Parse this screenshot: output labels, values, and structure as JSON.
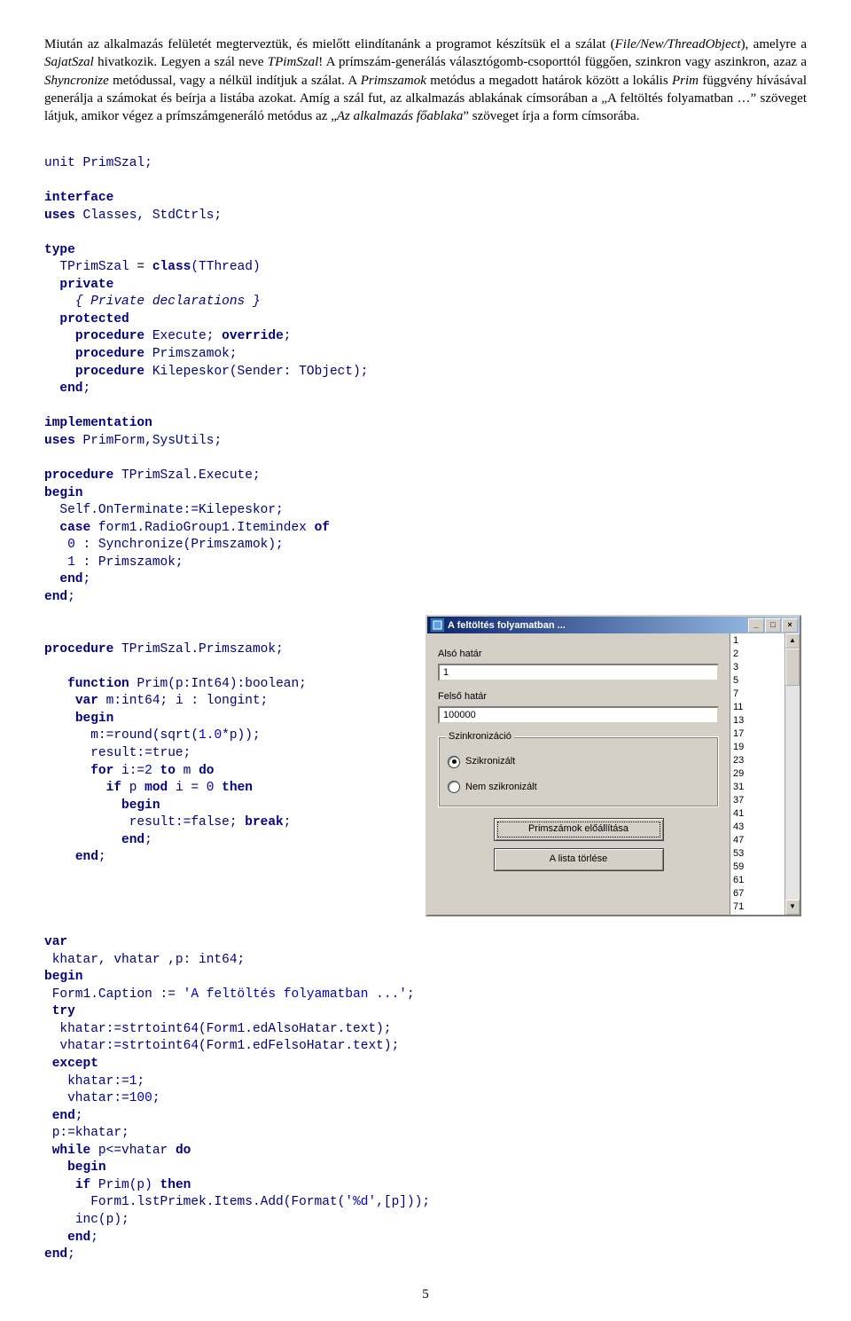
{
  "intro_html": "Miután az alkalmazás felületét megterveztük, és mielőtt elindítanánk a programot készítsük el a szálat (<i>File/New/ThreadObject</i>), amelyre a <i>SajatSzal</i> hivatkozik. Legyen a szál neve <i>TPimSzal</i>! A prímszám-generálás választógomb-csoporttól függően, szinkron vagy aszinkron, azaz a <i>Shyncronize</i> metódussal, vagy a nélkül indítjuk a szálat. A <i>Primszamok</i> metódus a megadott határok között a lokális <i>Prim</i> függvény hívásával generálja a számokat és beírja a listába azokat. Amíg a szál fut, az alkalmazás ablakának címsorában a „A feltöltés folyamatban …” szöveget látjuk, amikor végez a prímszámgeneráló metódus az „<i>Az alkalmazás főablaka</i>” szöveget írja a form címsorába.",
  "code1": "unit PrimSzal;",
  "code2_kw": "interface",
  "code3": "<span class='kw'>uses</span> <span class='id'>Classes, StdCtrls;</span>",
  "code4": "<span class='kw'>type</span>",
  "code5": "  <span class='id'>TPrimSzal</span> = <span class='kw'>class</span><span class='id'>(TThread)</span>",
  "code6": "  <span class='kw'>private</span>",
  "code7": "    <span class='cmt'>{ Private declarations }</span>",
  "code8": "  <span class='kw'>protected</span>",
  "code9": "    <span class='kw'>procedure</span> <span class='id'>Execute;</span> <span class='kw'>override</span><span class='id'>;</span>",
  "code10": "    <span class='kw'>procedure</span> <span class='id'>Primszamok;</span>",
  "code11": "    <span class='kw'>procedure</span> <span class='id'>Kilepeskor(Sender: TObject);</span>",
  "code12": "  <span class='kw'>end</span><span class='id'>;</span>",
  "code13": "<span class='kw'>implementation</span>",
  "code14": "<span class='kw'>uses</span> <span class='id'>PrimForm,SysUtils;</span>",
  "code15": "<span class='kw'>procedure</span> <span class='id'>TPrimSzal.Execute;</span>",
  "code16": "<span class='kw'>begin</span>",
  "code17": "  <span class='id'>Self.OnTerminate:=Kilepeskor;</span>",
  "code18": "  <span class='kw'>case</span> <span class='id'>form1.RadioGroup1.Itemindex</span> <span class='kw'>of</span>",
  "code19": "   <span class='num'>0</span> <span class='id'>: Synchronize(Primszamok);</span>",
  "code20": "   <span class='num'>1</span> <span class='id'>: Primszamok;</span>",
  "code21": "  <span class='kw'>end</span><span class='id'>;</span>",
  "code22": "<span class='kw'>end</span><span class='id'>;</span>",
  "code23": "<span class='kw'>procedure</span> <span class='id'>TPrimSzal.Primszamok;</span>",
  "code24": "   <span class='kw'>function</span> <span class='id'>Prim(p:Int64):boolean;</span>",
  "code25": "    <span class='kw'>var</span> <span class='id'>m:int64; i : longint;</span>",
  "code26": "    <span class='kw'>begin</span>",
  "code27": "      <span class='id'>m:=round(sqrt(</span><span class='num'>1.0</span><span class='id'>*p));</span>",
  "code28": "      <span class='id'>result:=true;</span>",
  "code29": "      <span class='kw'>for</span> <span class='id'>i:=</span><span class='num'>2</span> <span class='kw'>to</span> <span class='id'>m</span> <span class='kw'>do</span>",
  "code30": "        <span class='kw'>if</span> <span class='id'>p</span> <span class='kw'>mod</span> <span class='id'>i =</span> <span class='num'>0</span> <span class='kw'>then</span>",
  "code31": "          <span class='kw'>begin</span>",
  "code32": "           <span class='id'>result:=false;</span> <span class='kw'>break</span><span class='id'>;</span>",
  "code33": "          <span class='kw'>end</span><span class='id'>;</span>",
  "code34": "    <span class='kw'>end</span><span class='id'>;</span>",
  "code35": "<span class='kw'>var</span>",
  "code36": " <span class='id'>khatar, vhatar ,p: int64;</span>",
  "code37": "<span class='kw'>begin</span>",
  "code38": " <span class='id'>Form1.Caption :=</span> <span class='str'>'A feltöltés folyamatban ...'</span><span class='id'>;</span>",
  "code39": " <span class='kw'>try</span>",
  "code40": "  <span class='id'>khatar:=strtoint64(Form1.edAlsoHatar.text);</span>",
  "code41": "  <span class='id'>vhatar:=strtoint64(Form1.edFelsoHatar.text);</span>",
  "code42": " <span class='kw'>except</span>",
  "code43": "   <span class='id'>khatar:=</span><span class='num'>1</span><span class='id'>;</span>",
  "code44": "   <span class='id'>vhatar:=</span><span class='num'>100</span><span class='id'>;</span>",
  "code45": " <span class='kw'>end</span><span class='id'>;</span>",
  "code46": " <span class='id'>p:=khatar;</span>",
  "code47": " <span class='kw'>while</span> <span class='id'>p<=vhatar</span> <span class='kw'>do</span>",
  "code48": "   <span class='kw'>begin</span>",
  "code49": "    <span class='kw'>if</span> <span class='id'>Prim(p)</span> <span class='kw'>then</span>",
  "code50": "      <span class='id'>Form1.lstPrimek.Items.Add(Format(</span><span class='str'>'%d'</span><span class='id'>,[p]));</span>",
  "code51": "    <span class='id'>inc(p);</span>",
  "code52": "   <span class='kw'>end</span><span class='id'>;</span>",
  "code53": "<span class='kw'>end</span><span class='id'>;</span>",
  "form": {
    "title": "A feltöltés folyamatban ...",
    "label_also": "Alsó határ",
    "val_also": "1",
    "label_felso": "Felső határ",
    "val_felso": "100000",
    "group_title": "Szinkronizáció",
    "radio1": "Szikronizált",
    "radio2": "Nem szikronizált",
    "btn1": "Primszámok előállítása",
    "btn2": "A lista törlése",
    "list": [
      "1",
      "2",
      "3",
      "5",
      "7",
      "11",
      "13",
      "17",
      "19",
      "23",
      "29",
      "31",
      "37",
      "41",
      "43",
      "47",
      "53",
      "59",
      "61",
      "67",
      "71"
    ]
  },
  "pagenum": "5"
}
